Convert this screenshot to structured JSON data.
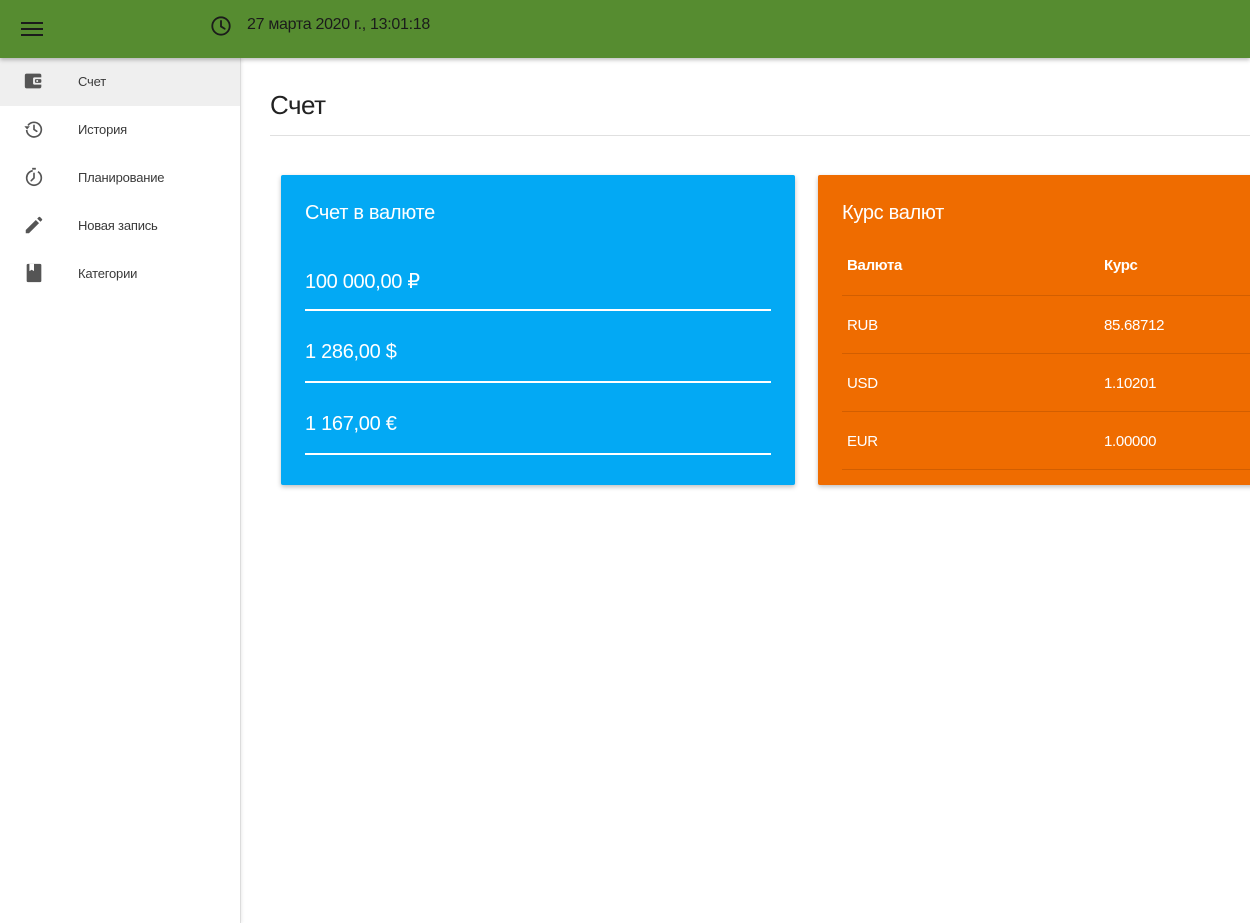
{
  "header": {
    "menu_icon": "hamburger-menu-icon",
    "clock_icon": "clock-icon",
    "datetime": "27 марта 2020 г., 13:01:18",
    "bg_color": "#568c30"
  },
  "sidebar": {
    "items": [
      {
        "label": "Счет",
        "icon": "wallet-icon",
        "active": true
      },
      {
        "label": "История",
        "icon": "history-icon",
        "active": false
      },
      {
        "label": "Планирование",
        "icon": "timer-icon",
        "active": false
      },
      {
        "label": "Новая запись",
        "icon": "pencil-icon",
        "active": false
      },
      {
        "label": "Категории",
        "icon": "book-icon",
        "active": false
      }
    ]
  },
  "main": {
    "title": "Счет",
    "balance_card": {
      "title": "Счет в валюте",
      "color": "#03a9f4",
      "amounts": [
        "100 000,00 ₽",
        "1 286,00 $",
        "1 167,00 €"
      ]
    },
    "rates_card": {
      "title": "Курс валют",
      "color": "#ef6c00",
      "headers": [
        "Валюта",
        "Курс"
      ],
      "rows": [
        {
          "currency": "RUB",
          "rate": "85.68712"
        },
        {
          "currency": "USD",
          "rate": "1.10201"
        },
        {
          "currency": "EUR",
          "rate": "1.00000"
        }
      ]
    }
  }
}
